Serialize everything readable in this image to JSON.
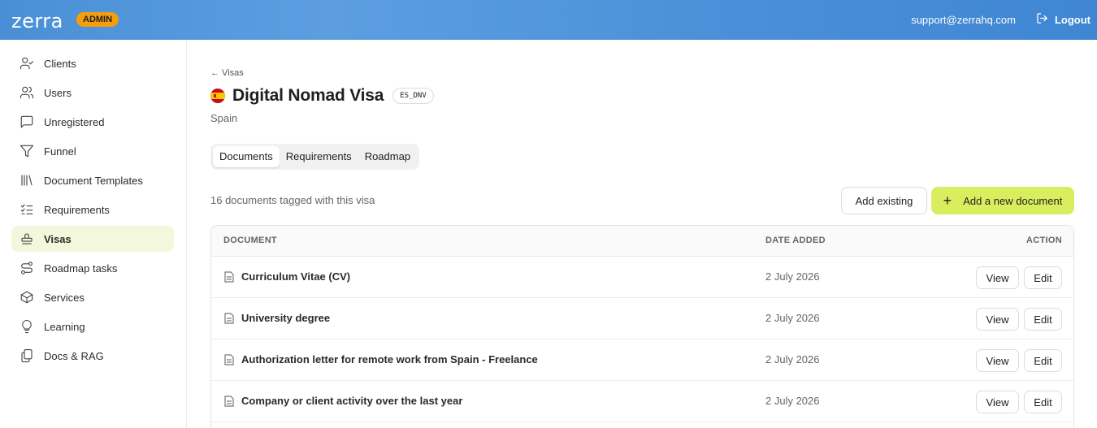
{
  "header": {
    "logo": "zerra",
    "badge": "ADMIN",
    "email": "support@zerrahq.com",
    "logout_label": "Logout"
  },
  "sidebar": {
    "items": [
      {
        "label": "Clients",
        "icon": "user-check-icon"
      },
      {
        "label": "Users",
        "icon": "users-icon"
      },
      {
        "label": "Unregistered",
        "icon": "message-square-icon"
      },
      {
        "label": "Funnel",
        "icon": "filter-icon"
      },
      {
        "label": "Document Templates",
        "icon": "library-icon"
      },
      {
        "label": "Requirements",
        "icon": "list-checks-icon"
      },
      {
        "label": "Visas",
        "icon": "stamp-icon",
        "active": true
      },
      {
        "label": "Roadmap tasks",
        "icon": "route-icon"
      },
      {
        "label": "Services",
        "icon": "package-icon"
      },
      {
        "label": "Learning",
        "icon": "lightbulb-icon"
      },
      {
        "label": "Docs & RAG",
        "icon": "files-icon"
      }
    ]
  },
  "page": {
    "back_label": "← Visas",
    "title": "Digital Nomad Visa",
    "code": "ES_DNV",
    "country": "Spain",
    "flag_icon": "spain-flag-icon",
    "tabs": [
      {
        "label": "Documents",
        "active": true
      },
      {
        "label": "Requirements"
      },
      {
        "label": "Roadmap"
      }
    ],
    "doc_count_text": "16 documents tagged with this visa",
    "add_existing_label": "Add existing",
    "add_new_label": "Add a new document",
    "accent_color": "#d8ee5e"
  },
  "table": {
    "columns": [
      "DOCUMENT",
      "DATE ADDED",
      "ACTION"
    ],
    "rows": [
      {
        "name": "Curriculum Vitae (CV)",
        "date": "2 July 2026",
        "view": "View",
        "edit": "Edit"
      },
      {
        "name": "University degree",
        "date": "2 July 2026",
        "view": "View",
        "edit": "Edit"
      },
      {
        "name": "Authorization letter for remote work from Spain - Freelance",
        "date": "2 July 2026",
        "view": "View",
        "edit": "Edit"
      },
      {
        "name": "Company or client activity over the last year",
        "date": "2 July 2026",
        "view": "View",
        "edit": "Edit"
      }
    ]
  }
}
